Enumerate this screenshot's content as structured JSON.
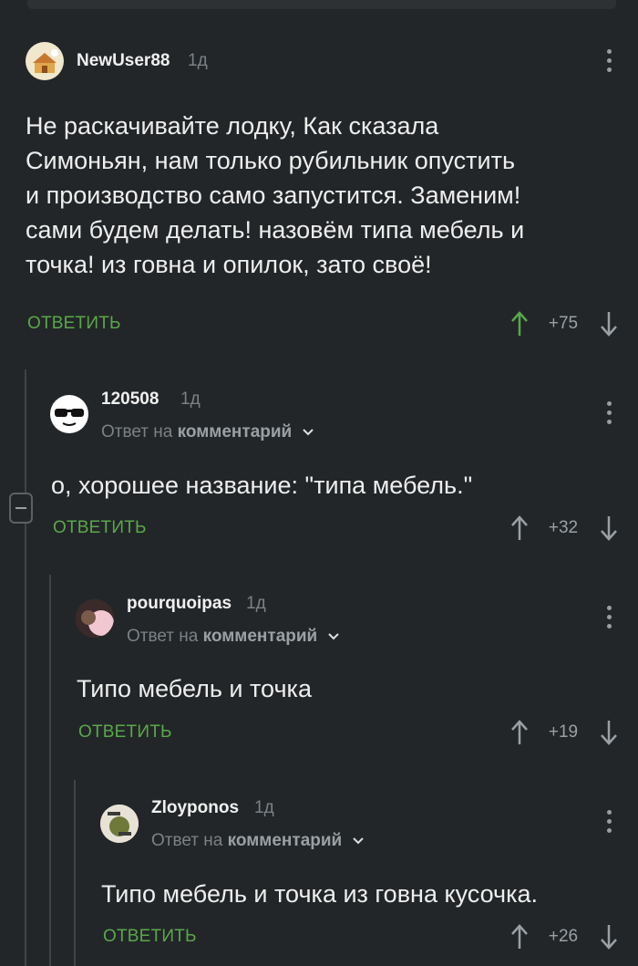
{
  "comments": [
    {
      "username": "NewUser88",
      "time": "1д",
      "reply_to_prefix": "",
      "reply_to_link": "",
      "lines": [
        "Не раскачивайте лодку, Как сказала",
        "Симоньян, нам только рубильник опустить",
        "и производство само запустится. Заменим!",
        "сами будем делать! назовём типа мебель и",
        "точка! из говна и опилок, зато своё!"
      ],
      "reply_label": "ОТВЕТИТЬ",
      "score": "+75",
      "upvoted": true
    },
    {
      "username": "120508",
      "time": "1д",
      "reply_to_prefix": "Ответ на",
      "reply_to_link": "комментарий",
      "lines": [
        "о, хорошее название: \"типа мебель.\""
      ],
      "reply_label": "ОТВЕТИТЬ",
      "score": "+32",
      "upvoted": false
    },
    {
      "username": "pourquoipas",
      "time": "1д",
      "reply_to_prefix": "Ответ на",
      "reply_to_link": "комментарий",
      "lines": [
        "Типо мебель и точка"
      ],
      "reply_label": "ОТВЕТИТЬ",
      "score": "+19",
      "upvoted": false
    },
    {
      "username": "Zloyponos",
      "time": "1д",
      "reply_to_prefix": "Ответ на",
      "reply_to_link": "комментарий",
      "lines": [
        "Типо мебель и точка из говна кусочка."
      ],
      "reply_label": "ОТВЕТИТЬ",
      "score": "+26",
      "upvoted": false
    }
  ],
  "colors": {
    "background": "#232628",
    "accent_green": "#59a84a",
    "muted": "#7c8185"
  },
  "icons": {
    "upvote": "arrow-up-icon",
    "downvote": "arrow-down-icon",
    "menu": "kebab-menu-icon",
    "collapse": "minus-icon",
    "expand": "chevron-down-icon"
  }
}
